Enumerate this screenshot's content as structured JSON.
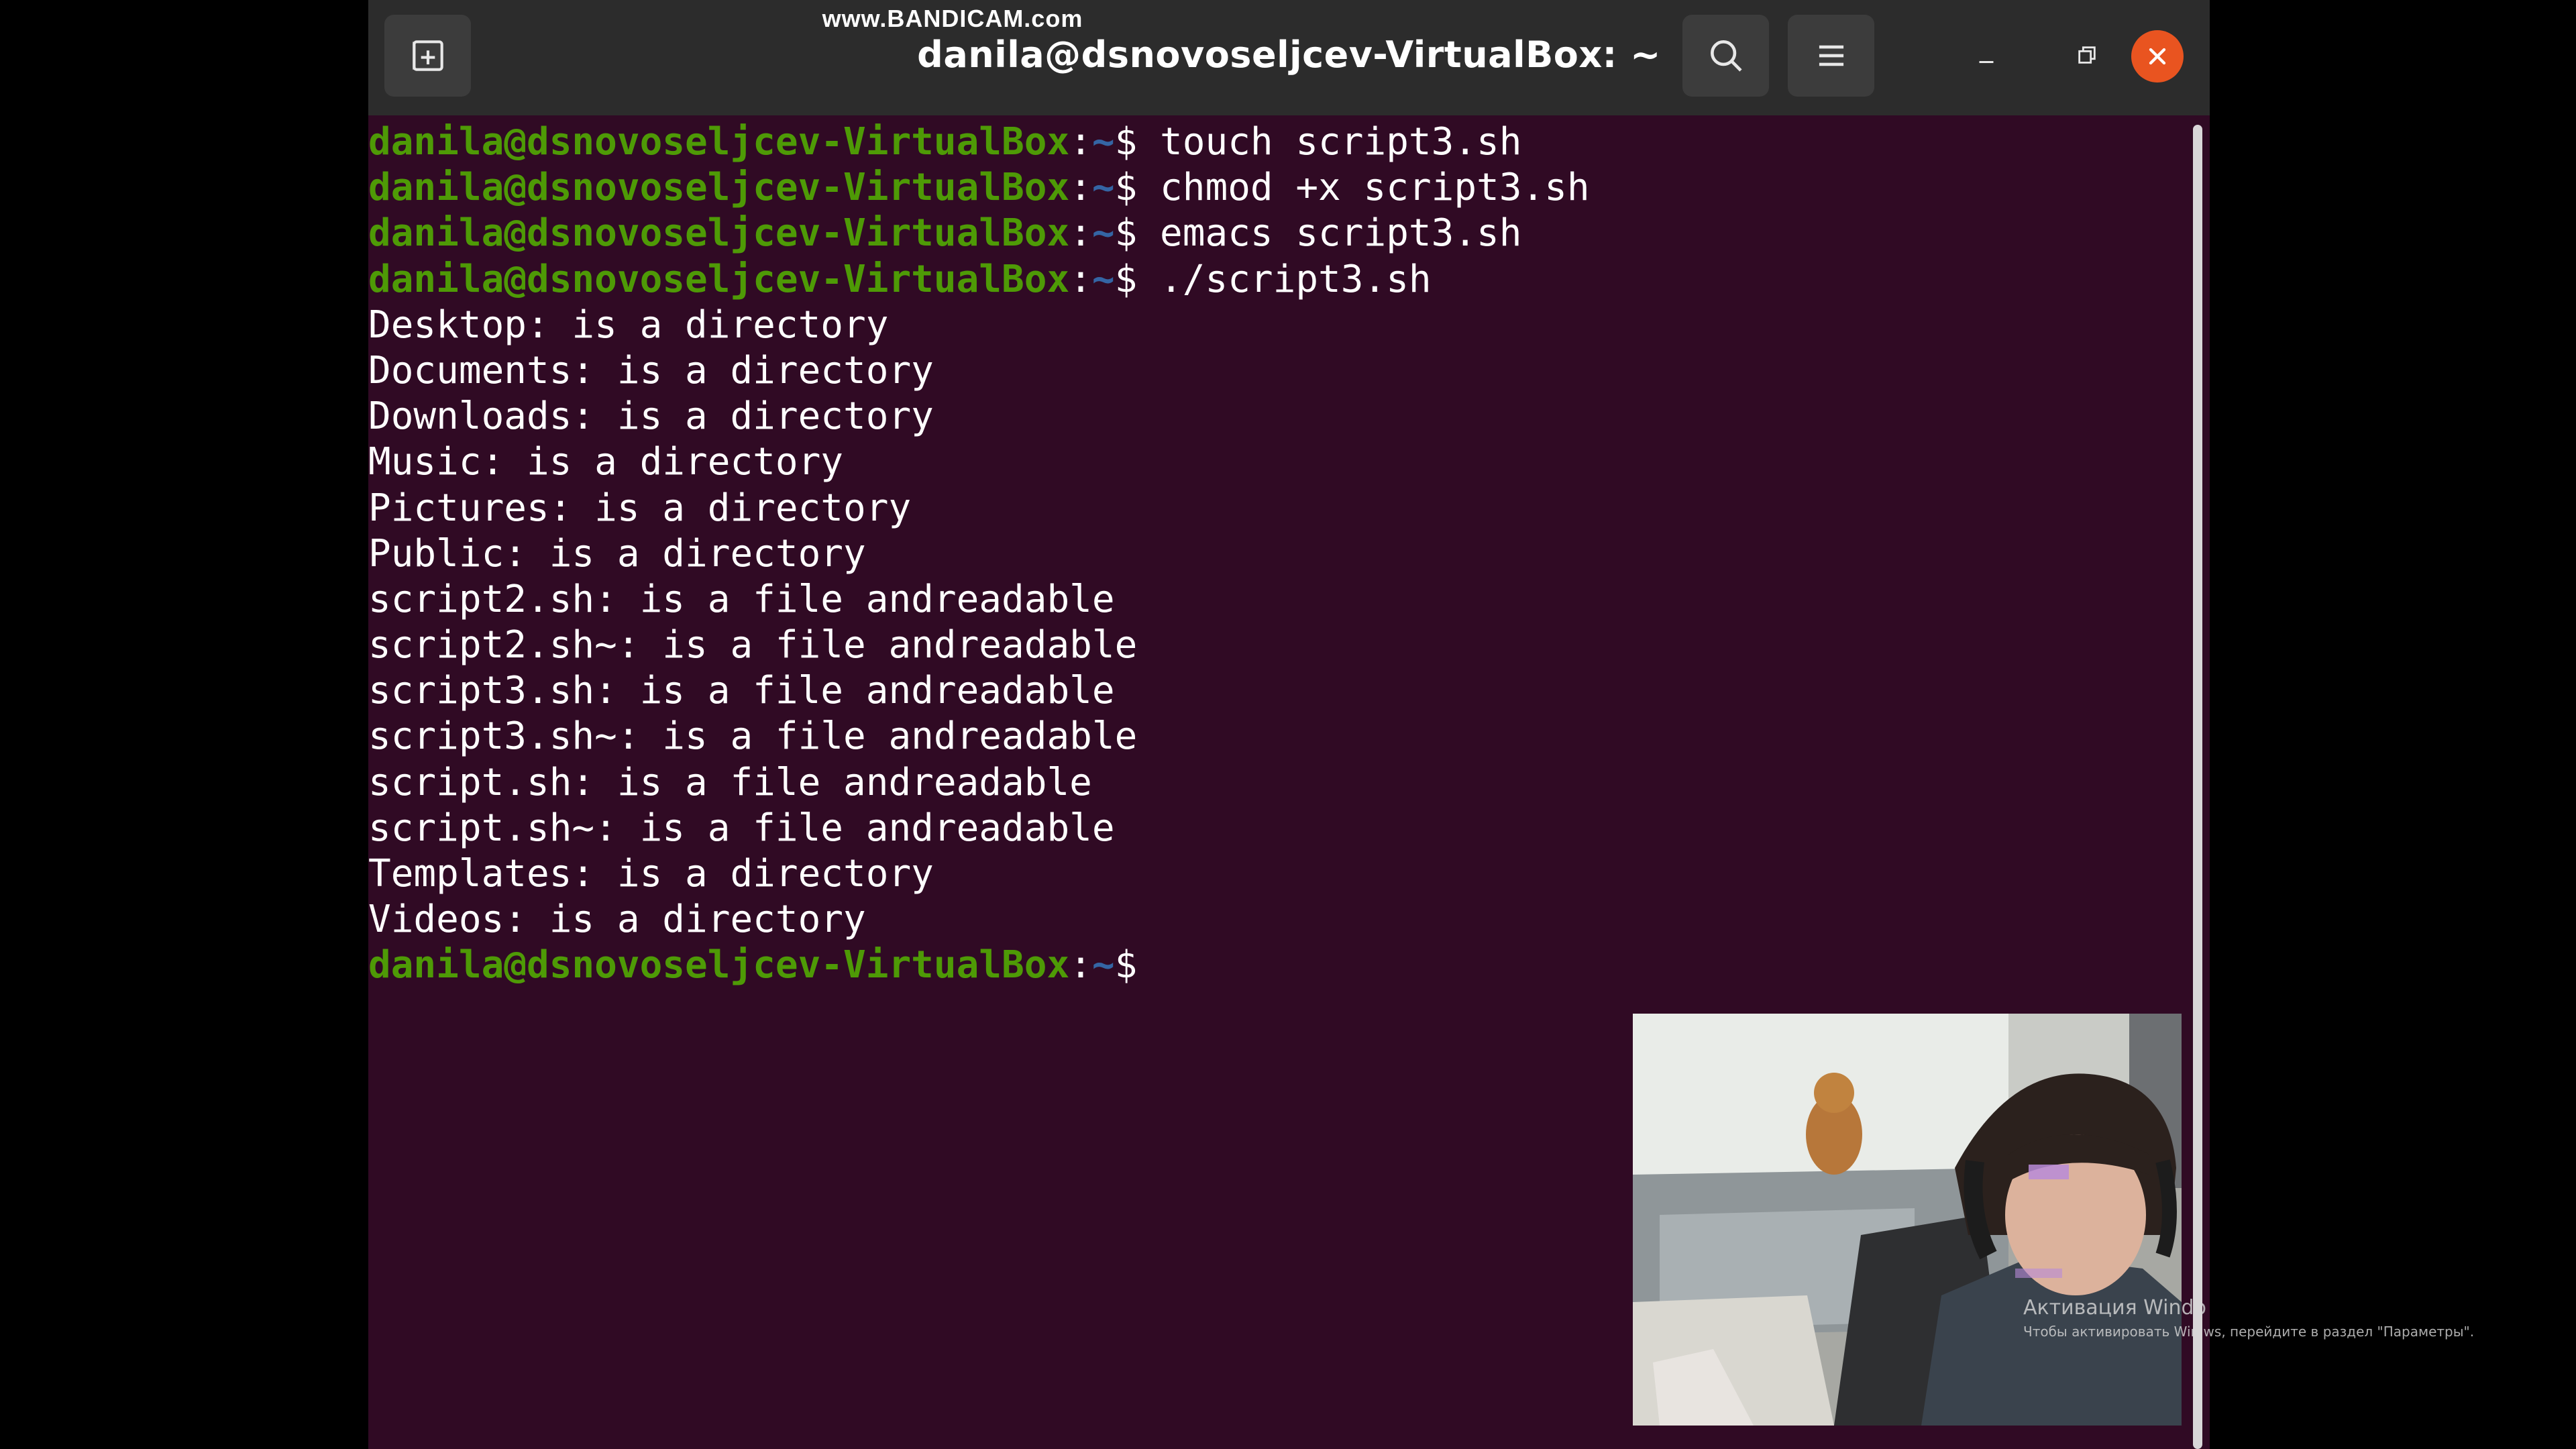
{
  "watermark": "www.BANDICAM.com",
  "window": {
    "title": "danila@dsnovoseljcev-VirtualBox: ~",
    "buttons": {
      "new_tab_icon": "new-tab-icon",
      "search_icon": "search-icon",
      "menu_icon": "hamburger-menu-icon",
      "minimize_icon": "minimize-icon",
      "restore_icon": "restore-icon",
      "close_icon": "close-icon"
    },
    "colors": {
      "terminal_bg": "#300a24",
      "titlebar_bg": "#2c2c2c",
      "prompt_user": "#4e9a06",
      "prompt_path": "#3465a4",
      "close_button": "#e95420"
    }
  },
  "terminal": {
    "prompt_user": "danila@dsnovoseljcev-VirtualBox",
    "prompt_path": "~",
    "prompt_symbol": "$",
    "lines": [
      {
        "prompt": true,
        "cmd": " touch script3.sh"
      },
      {
        "prompt": true,
        "cmd": " chmod +x script3.sh"
      },
      {
        "prompt": true,
        "cmd": " emacs script3.sh"
      },
      {
        "prompt": true,
        "cmd": " ./script3.sh"
      },
      {
        "prompt": false,
        "text": "Desktop: is a directory"
      },
      {
        "prompt": false,
        "text": "Documents: is a directory"
      },
      {
        "prompt": false,
        "text": "Downloads: is a directory"
      },
      {
        "prompt": false,
        "text": "Music: is a directory"
      },
      {
        "prompt": false,
        "text": "Pictures: is a directory"
      },
      {
        "prompt": false,
        "text": "Public: is a directory"
      },
      {
        "prompt": false,
        "text": "script2.sh: is a file andreadable"
      },
      {
        "prompt": false,
        "text": "script2.sh~: is a file andreadable"
      },
      {
        "prompt": false,
        "text": "script3.sh: is a file andreadable"
      },
      {
        "prompt": false,
        "text": "script3.sh~: is a file andreadable"
      },
      {
        "prompt": false,
        "text": "script.sh: is a file andreadable"
      },
      {
        "prompt": false,
        "text": "script.sh~: is a file andreadable"
      },
      {
        "prompt": false,
        "text": "Templates: is a directory"
      },
      {
        "prompt": false,
        "text": "Videos: is a directory"
      },
      {
        "prompt": true,
        "cmd": ""
      }
    ]
  },
  "activation": {
    "title": "Активация Windo",
    "subtitle": "Чтобы активировать Win    ws, перейдите в раздел \"Параметры\"."
  }
}
